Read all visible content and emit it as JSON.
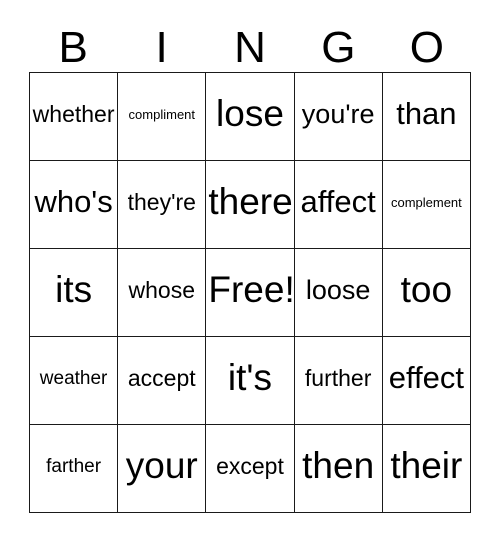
{
  "card": {
    "title": "BINGO",
    "headers": [
      "B",
      "I",
      "N",
      "G",
      "O"
    ],
    "rows": [
      [
        {
          "text": "whether",
          "size": "fs-m"
        },
        {
          "text": "compliment",
          "size": "fs-xs"
        },
        {
          "text": "lose",
          "size": "fs-xxl"
        },
        {
          "text": "you're",
          "size": "fs-l"
        },
        {
          "text": "than",
          "size": "fs-xl"
        }
      ],
      [
        {
          "text": "who's",
          "size": "fs-xl"
        },
        {
          "text": "they're",
          "size": "fs-m"
        },
        {
          "text": "there",
          "size": "fs-xxl"
        },
        {
          "text": "affect",
          "size": "fs-xl"
        },
        {
          "text": "complement",
          "size": "fs-xs"
        }
      ],
      [
        {
          "text": "its",
          "size": "fs-xxl"
        },
        {
          "text": "whose",
          "size": "fs-m"
        },
        {
          "text": "Free!",
          "size": "fs-xxl"
        },
        {
          "text": "loose",
          "size": "fs-l"
        },
        {
          "text": "too",
          "size": "fs-xxl"
        }
      ],
      [
        {
          "text": "weather",
          "size": "fs-s"
        },
        {
          "text": "accept",
          "size": "fs-m"
        },
        {
          "text": "it's",
          "size": "fs-xxl"
        },
        {
          "text": "further",
          "size": "fs-m"
        },
        {
          "text": "effect",
          "size": "fs-xl"
        }
      ],
      [
        {
          "text": "farther",
          "size": "fs-s"
        },
        {
          "text": "your",
          "size": "fs-xxl"
        },
        {
          "text": "except",
          "size": "fs-m"
        },
        {
          "text": "then",
          "size": "fs-xxl"
        },
        {
          "text": "their",
          "size": "fs-xxl"
        }
      ]
    ]
  }
}
